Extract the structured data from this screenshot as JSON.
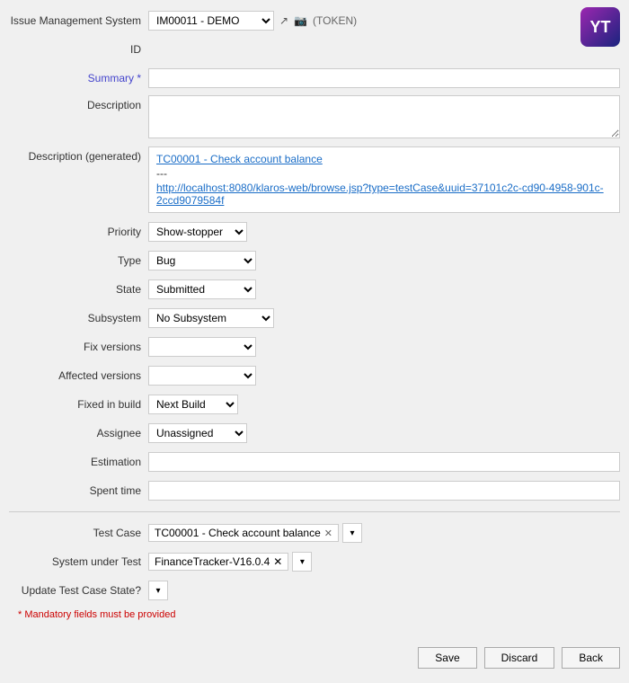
{
  "header": {
    "ims_label": "Issue Management System",
    "ims_value": "IM00011 - DEMO",
    "token_text": "(TOKEN)",
    "logo_text": "YT"
  },
  "fields": {
    "id_label": "ID",
    "summary_label": "Summary *",
    "description_label": "Description",
    "desc_generated_label": "Description (generated)",
    "desc_generated_link": "TC00001 - Check account balance",
    "desc_generated_sep": "---",
    "desc_generated_url": "http://localhost:8080/klaros-web/browse.jsp?type=testCase&uuid=37101c2c-cd90-4958-901c-2ccd9079584f",
    "priority_label": "Priority",
    "priority_value": "Show-stopper",
    "type_label": "Type",
    "type_value": "Bug",
    "state_label": "State",
    "state_value": "Submitted",
    "subsystem_label": "Subsystem",
    "subsystem_value": "No Subsystem",
    "fix_versions_label": "Fix versions",
    "affected_versions_label": "Affected versions",
    "fixed_in_build_label": "Fixed in build",
    "fixed_in_build_value": "Next Build",
    "assignee_label": "Assignee",
    "assignee_value": "Unassigned",
    "estimation_label": "Estimation",
    "spent_time_label": "Spent time",
    "test_case_label": "Test Case",
    "test_case_value": "TC00001 - Check account balance",
    "sut_label": "System under Test",
    "sut_value": "FinanceTracker-V16.0.4",
    "update_state_label": "Update Test Case State?",
    "mandatory_note": "* Mandatory fields must be provided"
  },
  "buttons": {
    "save": "Save",
    "discard": "Discard",
    "back": "Back"
  },
  "dropdowns": {
    "chevron": "▾",
    "x": "✕"
  }
}
